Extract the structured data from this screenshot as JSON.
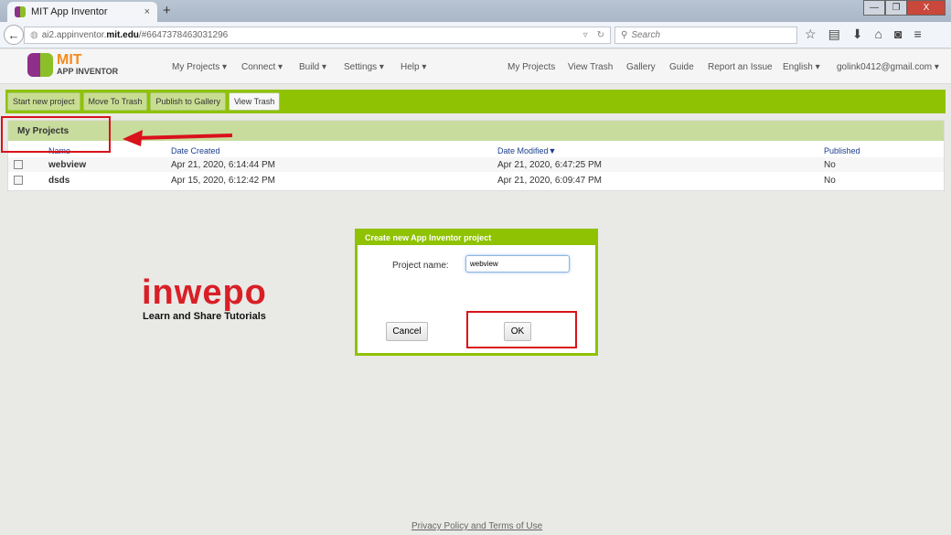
{
  "browser": {
    "tab_title": "MIT App Inventor",
    "tab_close": "×",
    "new_tab": "+",
    "url_host_prefix": "ai2.appinventor.",
    "url_host_bold": "mit.edu",
    "url_path": "/#6647378463031296",
    "search_placeholder": "Search",
    "win": {
      "min": "—",
      "max": "❐",
      "close": "X"
    }
  },
  "logo": {
    "line1": "MIT",
    "line2": "APP INVENTOR"
  },
  "menu_left": [
    "My Projects ▾",
    "Connect ▾",
    "Build ▾",
    "Settings ▾",
    "Help ▾"
  ],
  "menu_right": [
    "My Projects",
    "View Trash",
    "Gallery",
    "Guide",
    "Report an Issue",
    "English ▾",
    "golink0412@gmail.com ▾"
  ],
  "toolbar": {
    "start": "Start new project",
    "trash": "Move To Trash",
    "publish": "Publish to Gallery",
    "view_trash": "View Trash"
  },
  "projects": {
    "title": "My Projects",
    "headers": [
      "Name",
      "Date Created",
      "Date Modified▼",
      "Published"
    ],
    "rows": [
      [
        "webview",
        "Apr 21, 2020, 6:14:44 PM",
        "Apr 21, 2020, 6:47:25 PM",
        "No"
      ],
      [
        "dsds",
        "Apr 15, 2020, 6:12:42 PM",
        "Apr 21, 2020, 6:09:47 PM",
        "No"
      ]
    ]
  },
  "dialog": {
    "title": "Create new App Inventor project",
    "label": "Project name:",
    "value": "webview",
    "cancel": "Cancel",
    "ok": "OK"
  },
  "watermark": {
    "brand": "inwepo",
    "tagline": "Learn and Share Tutorials"
  },
  "footer": "Privacy Policy and Terms of Use"
}
